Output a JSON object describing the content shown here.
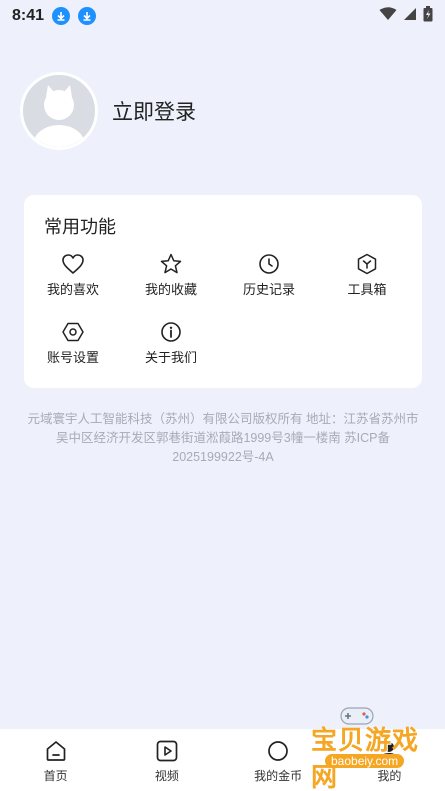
{
  "status_bar": {
    "time": "8:41"
  },
  "profile": {
    "login_label": "立即登录"
  },
  "common_functions": {
    "title": "常用功能",
    "items": [
      {
        "label": "我的喜欢",
        "icon": "heart-icon"
      },
      {
        "label": "我的收藏",
        "icon": "star-icon"
      },
      {
        "label": "历史记录",
        "icon": "clock-icon"
      },
      {
        "label": "工具箱",
        "icon": "toolbox-icon"
      },
      {
        "label": "账号设置",
        "icon": "settings-icon"
      },
      {
        "label": "关于我们",
        "icon": "info-icon"
      }
    ]
  },
  "footer": {
    "company": "元域寰宇人工智能科技（苏州）有限公司版权所有 地址：江苏省苏州市吴中区经济开发区郭巷街道淞葭路1999号3幢一楼南 苏ICP备2025199922号-4A"
  },
  "tabbar": {
    "tabs": [
      {
        "label": "首页",
        "icon": "home-icon"
      },
      {
        "label": "视频",
        "icon": "video-icon"
      },
      {
        "label": "我的金币",
        "icon": "coin-icon"
      },
      {
        "label": "我的",
        "icon": "user-icon"
      }
    ]
  },
  "watermark": {
    "text": "宝贝游戏网",
    "url": "baobeiy.com"
  }
}
